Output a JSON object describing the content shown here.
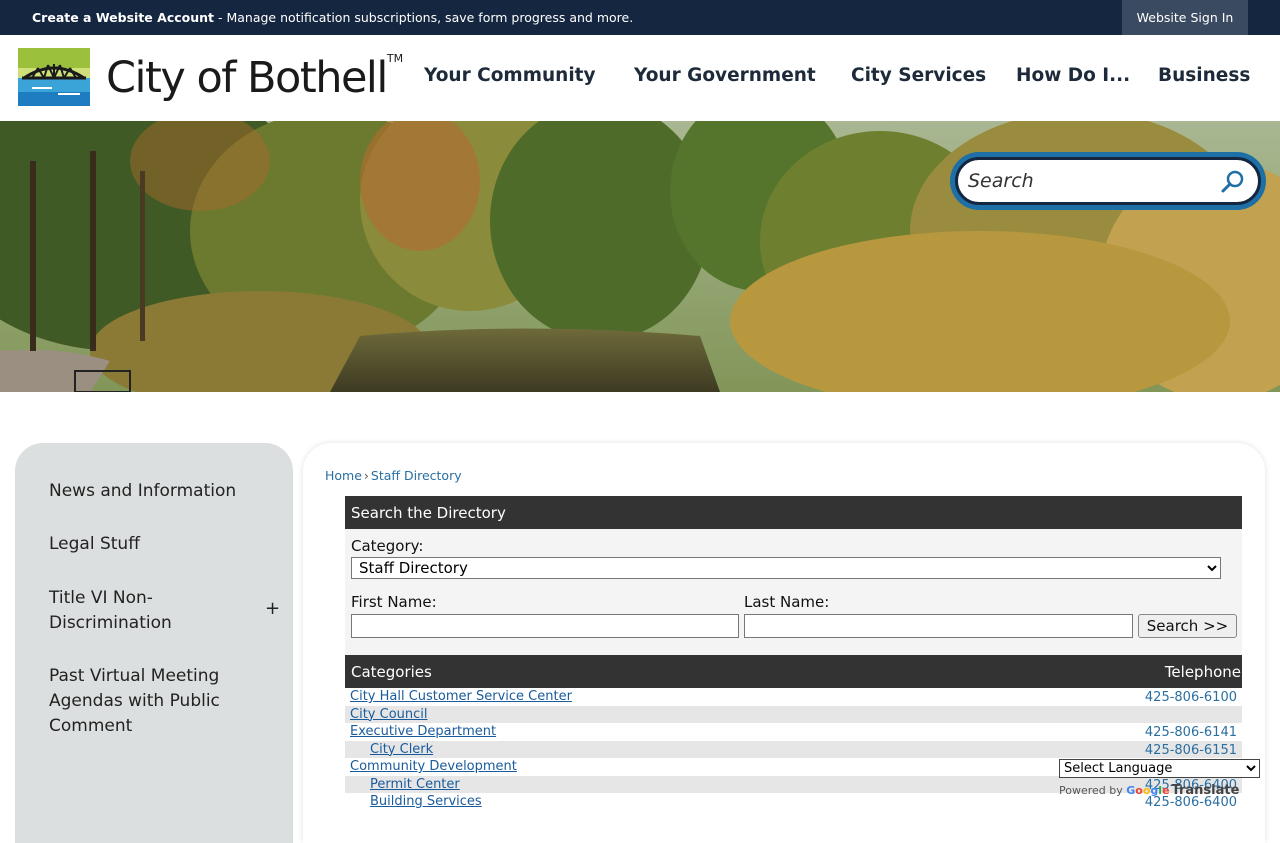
{
  "topbar": {
    "create_account_bold": "Create a Website Account",
    "create_account_rest": " - Manage notification subscriptions, save form progress and more.",
    "sign_in": "Website Sign In"
  },
  "header": {
    "logo_text": "City of Bothell",
    "logo_tm": "TM",
    "nav": [
      "Your Community",
      "Your Government",
      "City Services",
      "How Do I...",
      "Business"
    ]
  },
  "search": {
    "placeholder": "Search"
  },
  "sidebar": {
    "items": [
      "News and Information",
      "Legal Stuff",
      "Title VI Non-Discrimination",
      "Past Virtual Meeting Agendas with Public Comment"
    ],
    "toggle": "+"
  },
  "breadcrumb": {
    "home": "Home",
    "sep": "›",
    "current": "Staff Directory"
  },
  "directory": {
    "heading": "Search the Directory",
    "category_label": "Category:",
    "category_value": "Staff Directory",
    "first_name_label": "First Name:",
    "last_name_label": "Last Name:",
    "search_button": "Search >>"
  },
  "categories_table": {
    "col_categories": "Categories",
    "col_telephone": "Telephone",
    "rows": [
      {
        "name": "City Hall Customer Service Center",
        "tel": "425-806-6100",
        "indent": 0
      },
      {
        "name": "City Council",
        "tel": "",
        "indent": 0
      },
      {
        "name": "Executive Department",
        "tel": "425-806-6141",
        "indent": 0
      },
      {
        "name": "City Clerk",
        "tel": "425-806-6151",
        "indent": 1
      },
      {
        "name": "Community Development",
        "tel": "",
        "indent": 0
      },
      {
        "name": "Permit Center",
        "tel": "425-806-6400",
        "indent": 1
      },
      {
        "name": "Building Services",
        "tel": "425-806-6400",
        "indent": 1
      }
    ]
  },
  "translate": {
    "select": "Select Language",
    "powered_by": "Powered by",
    "google": "Google",
    "translate": "Translate"
  },
  "colors": {
    "topbar": "#142640",
    "link": "#1a5b9c",
    "table_header": "#333333",
    "search_ring": "#1d6fa6"
  }
}
